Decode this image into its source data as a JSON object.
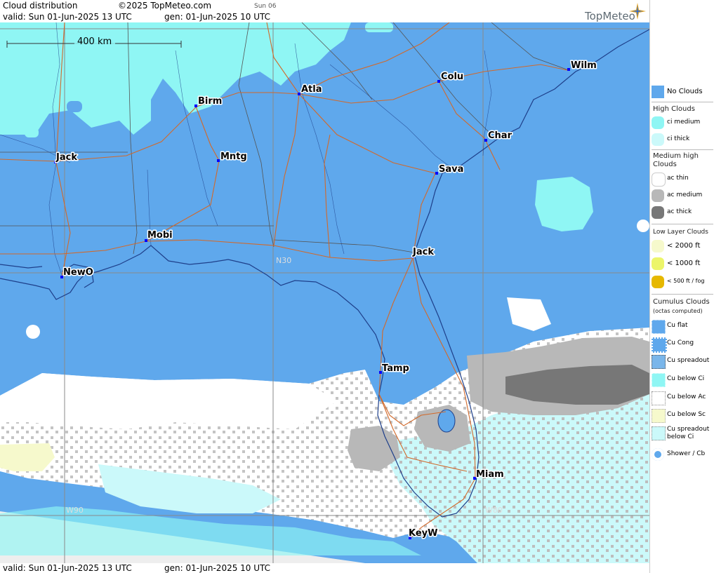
{
  "header": {
    "title": "Cloud distribution",
    "copyright": "©2025 TopMeteo.com",
    "day_tag": "Sun 06",
    "valid_line": "valid:  Sun  01-Jun-2025  13 UTC",
    "gen_line": "gen: 01-Jun-2025 10 UTC",
    "logo": "TopMeteo"
  },
  "footer": {
    "valid_line": "valid:  Sun  01-Jun-2025  13 UTC",
    "gen_line": "gen: 01-Jun-2025 10 UTC"
  },
  "map": {
    "scale_label": "400 km",
    "grid_labels": {
      "lat": "N30",
      "lon_west": "W90",
      "lon_east": "W80"
    },
    "cities": [
      {
        "name": "Birm"
      },
      {
        "name": "Atla"
      },
      {
        "name": "Colu"
      },
      {
        "name": "Wilm"
      },
      {
        "name": "Char"
      },
      {
        "name": "Jack"
      },
      {
        "name": "Mntg"
      },
      {
        "name": "Sava"
      },
      {
        "name": "Mobi"
      },
      {
        "name": "Jack"
      },
      {
        "name": "NewO"
      },
      {
        "name": "Tamp"
      },
      {
        "name": "Miam"
      },
      {
        "name": "KeyW"
      }
    ],
    "colors": {
      "no_clouds": "#5fa8ec",
      "ci_medium": "#8ff6f4",
      "ci_thick": "#cbf9fa",
      "ac_thin": "#ffffff",
      "ac_medium": "#b8b8b8",
      "ac_thick": "#777777",
      "low_2000": "#f6f9cc",
      "low_1000": "#ecf56a",
      "fog": "#e6b800",
      "outside": "#eeeeee",
      "road": "#d2692a",
      "coast": "#1e3f8a",
      "border": "#555555",
      "city_marker": "#0000ff"
    }
  },
  "legend": {
    "no_clouds": "No Clouds",
    "high_clouds_head": "High Clouds",
    "ci_medium": "ci medium",
    "ci_thick": "ci thick",
    "medium_head": "Medium high Clouds",
    "ac_thin": "ac thin",
    "ac_medium": "ac medium",
    "ac_thick": "ac thick",
    "low_head": "Low Layer Clouds",
    "low_2000": "< 2000 ft",
    "low_1000": "< 1000 ft",
    "low_500": "< 500 ft / fog",
    "cumulus_head": "Cumulus Clouds",
    "cumulus_sub": "(octas computed)",
    "cu_flat": "Cu flat",
    "cu_cong": "Cu Cong",
    "cu_spreadout": "Cu spreadout",
    "cu_below_ci": "Cu below Ci",
    "cu_below_ac": "Cu below Ac",
    "cu_below_sc": "Cu below Sc",
    "cu_spreadout_below_ci": "Cu spreadout below Ci",
    "shower_cb": "Shower / Cb"
  }
}
